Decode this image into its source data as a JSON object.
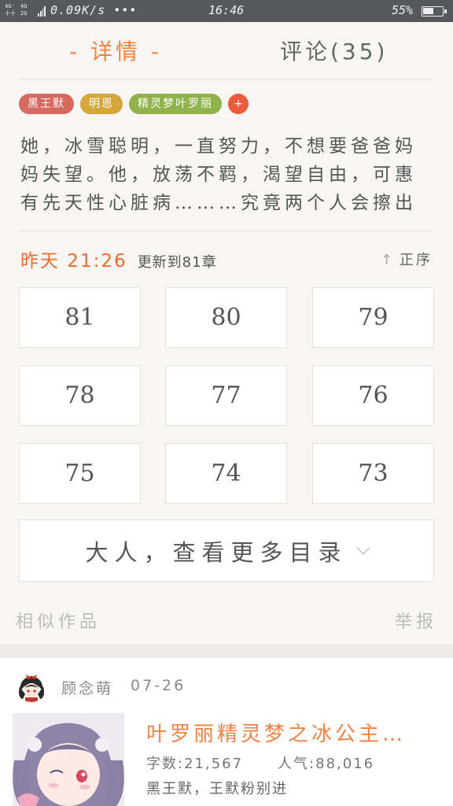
{
  "status_bar": {
    "network_top": "4G⁺",
    "network_bottom": "十十",
    "network2_top": "4G",
    "network2_bottom": "2G",
    "speed": "0.09K/s",
    "overflow": "•••",
    "time": "16:46",
    "battery_percent": "55%",
    "battery_level": 0.55
  },
  "tabs": {
    "detail": "- 详情 -",
    "comments": "评论(35)"
  },
  "tags": [
    {
      "label": "黑王默",
      "color": "#d66a60"
    },
    {
      "label": "明恩",
      "color": "#d4a63b"
    },
    {
      "label": "精灵梦叶罗丽",
      "color": "#8fb24a"
    }
  ],
  "tag_add": "+",
  "synopsis": [
    "她，冰雪聪明，一直努力，不想要爸爸妈",
    "妈失望。他，放荡不羁，渴望自由，可惠",
    "有先天性心脏病………究竟两个人会擦出"
  ],
  "update": {
    "time": "昨天 21:26",
    "text": "更新到81章",
    "sort_label": "正序",
    "sort_icon": "↑"
  },
  "chapters": [
    "81",
    "80",
    "79",
    "78",
    "77",
    "76",
    "75",
    "74",
    "73"
  ],
  "more_catalog": "大人，查看更多目录",
  "similar": {
    "title": "相似作品",
    "report": "举报"
  },
  "similar_book": {
    "author": "顾念萌",
    "date": "07-26",
    "title": "叶罗丽精灵梦之冰公主…",
    "word_count": "字数:21,567",
    "popularity": "人气:88,016",
    "tags": "黑王默，王默粉别进"
  }
}
